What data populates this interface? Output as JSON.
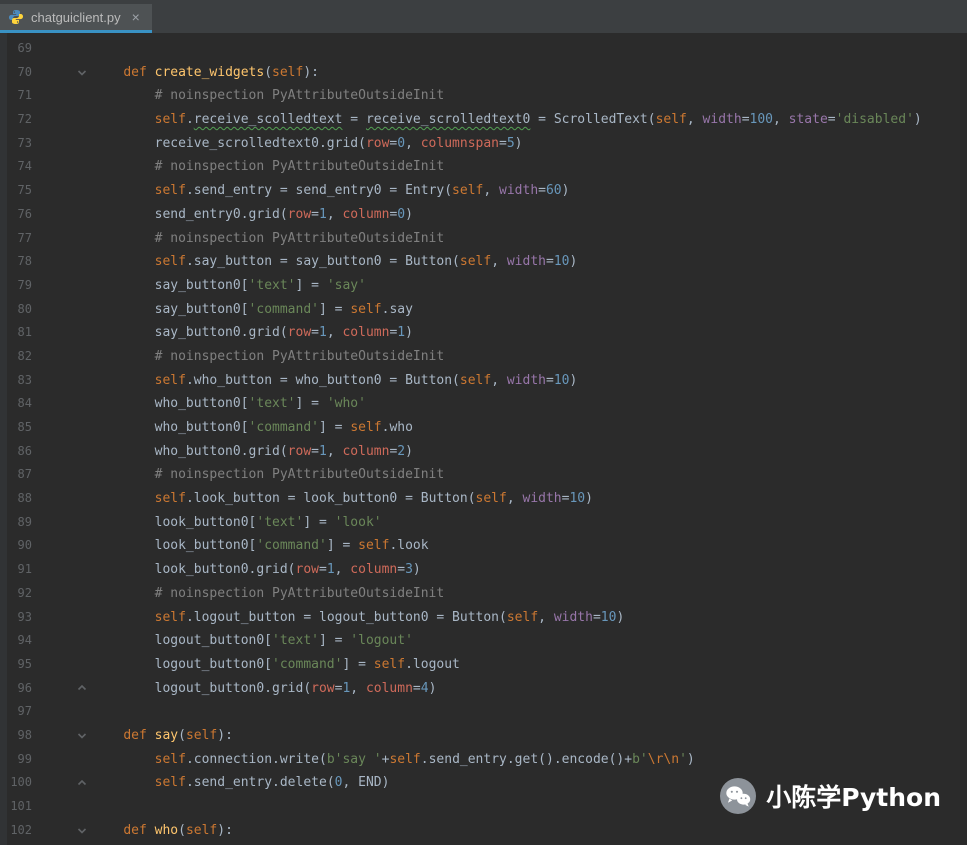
{
  "tab": {
    "filename": "chatguiclient.py",
    "close_label": "×"
  },
  "colors": {
    "editor_bg": "#2b2b2b",
    "tabbar_bg": "#3c3f41",
    "active_tab_bg": "#4e5254",
    "active_tab_accent": "#3992c4",
    "keyword": "#cc7832",
    "function_name": "#ffc66d",
    "string": "#6a8759",
    "number": "#6897bb",
    "comment": "#808080",
    "typo_squiggle": "#54a054"
  },
  "watermark": {
    "text": "小陈学Python"
  },
  "code": {
    "lines": [
      {
        "n": 69,
        "t": []
      },
      {
        "n": 70,
        "fold": "down",
        "t": [
          [
            "d",
            "    "
          ],
          [
            "k",
            "def"
          ],
          [
            "d",
            " "
          ],
          [
            "f",
            "create_widgets"
          ],
          [
            "d",
            "("
          ],
          [
            "k",
            "self"
          ],
          [
            "d",
            "):"
          ]
        ]
      },
      {
        "n": 71,
        "t": [
          [
            "d",
            "        "
          ],
          [
            "c",
            "# noinspection PyAttributeOutsideInit"
          ]
        ]
      },
      {
        "n": 72,
        "t": [
          [
            "d",
            "        "
          ],
          [
            "k",
            "self"
          ],
          [
            "d",
            "."
          ],
          [
            "u",
            "receive_scolledtext"
          ],
          [
            "d",
            " = "
          ],
          [
            "u",
            "receive_scrolledtext0"
          ],
          [
            "d",
            " = ScrolledText("
          ],
          [
            "k",
            "self"
          ],
          [
            "d",
            ", "
          ],
          [
            "p",
            "width"
          ],
          [
            "d",
            "="
          ],
          [
            "n",
            "100"
          ],
          [
            "d",
            ", "
          ],
          [
            "p",
            "state"
          ],
          [
            "d",
            "="
          ],
          [
            "s",
            "'disabled'"
          ],
          [
            "d",
            ")"
          ]
        ]
      },
      {
        "n": 73,
        "t": [
          [
            "d",
            "        receive_scrolledtext0.grid("
          ],
          [
            "r",
            "row"
          ],
          [
            "d",
            "="
          ],
          [
            "n",
            "0"
          ],
          [
            "d",
            ", "
          ],
          [
            "r",
            "columnspan"
          ],
          [
            "d",
            "="
          ],
          [
            "n",
            "5"
          ],
          [
            "d",
            ")"
          ]
        ]
      },
      {
        "n": 74,
        "t": [
          [
            "d",
            "        "
          ],
          [
            "c",
            "# noinspection PyAttributeOutsideInit"
          ]
        ]
      },
      {
        "n": 75,
        "t": [
          [
            "d",
            "        "
          ],
          [
            "k",
            "self"
          ],
          [
            "d",
            ".send_entry = send_entry0 = Entry("
          ],
          [
            "k",
            "self"
          ],
          [
            "d",
            ", "
          ],
          [
            "p",
            "width"
          ],
          [
            "d",
            "="
          ],
          [
            "n",
            "60"
          ],
          [
            "d",
            ")"
          ]
        ]
      },
      {
        "n": 76,
        "t": [
          [
            "d",
            "        send_entry0.grid("
          ],
          [
            "r",
            "row"
          ],
          [
            "d",
            "="
          ],
          [
            "n",
            "1"
          ],
          [
            "d",
            ", "
          ],
          [
            "r",
            "column"
          ],
          [
            "d",
            "="
          ],
          [
            "n",
            "0"
          ],
          [
            "d",
            ")"
          ]
        ]
      },
      {
        "n": 77,
        "t": [
          [
            "d",
            "        "
          ],
          [
            "c",
            "# noinspection PyAttributeOutsideInit"
          ]
        ]
      },
      {
        "n": 78,
        "t": [
          [
            "d",
            "        "
          ],
          [
            "k",
            "self"
          ],
          [
            "d",
            ".say_button = say_button0 = Button("
          ],
          [
            "k",
            "self"
          ],
          [
            "d",
            ", "
          ],
          [
            "p",
            "width"
          ],
          [
            "d",
            "="
          ],
          [
            "n",
            "10"
          ],
          [
            "d",
            ")"
          ]
        ]
      },
      {
        "n": 79,
        "t": [
          [
            "d",
            "        say_button0["
          ],
          [
            "s",
            "'text'"
          ],
          [
            "d",
            "] = "
          ],
          [
            "s",
            "'say'"
          ]
        ]
      },
      {
        "n": 80,
        "t": [
          [
            "d",
            "        say_button0["
          ],
          [
            "s",
            "'command'"
          ],
          [
            "d",
            "] = "
          ],
          [
            "k",
            "self"
          ],
          [
            "d",
            ".say"
          ]
        ]
      },
      {
        "n": 81,
        "t": [
          [
            "d",
            "        say_button0.grid("
          ],
          [
            "r",
            "row"
          ],
          [
            "d",
            "="
          ],
          [
            "n",
            "1"
          ],
          [
            "d",
            ", "
          ],
          [
            "r",
            "column"
          ],
          [
            "d",
            "="
          ],
          [
            "n",
            "1"
          ],
          [
            "d",
            ")"
          ]
        ]
      },
      {
        "n": 82,
        "t": [
          [
            "d",
            "        "
          ],
          [
            "c",
            "# noinspection PyAttributeOutsideInit"
          ]
        ]
      },
      {
        "n": 83,
        "t": [
          [
            "d",
            "        "
          ],
          [
            "k",
            "self"
          ],
          [
            "d",
            ".who_button = who_button0 = Button("
          ],
          [
            "k",
            "self"
          ],
          [
            "d",
            ", "
          ],
          [
            "p",
            "width"
          ],
          [
            "d",
            "="
          ],
          [
            "n",
            "10"
          ],
          [
            "d",
            ")"
          ]
        ]
      },
      {
        "n": 84,
        "t": [
          [
            "d",
            "        who_button0["
          ],
          [
            "s",
            "'text'"
          ],
          [
            "d",
            "] = "
          ],
          [
            "s",
            "'who'"
          ]
        ]
      },
      {
        "n": 85,
        "t": [
          [
            "d",
            "        who_button0["
          ],
          [
            "s",
            "'command'"
          ],
          [
            "d",
            "] = "
          ],
          [
            "k",
            "self"
          ],
          [
            "d",
            ".who"
          ]
        ]
      },
      {
        "n": 86,
        "t": [
          [
            "d",
            "        who_button0.grid("
          ],
          [
            "r",
            "row"
          ],
          [
            "d",
            "="
          ],
          [
            "n",
            "1"
          ],
          [
            "d",
            ", "
          ],
          [
            "r",
            "column"
          ],
          [
            "d",
            "="
          ],
          [
            "n",
            "2"
          ],
          [
            "d",
            ")"
          ]
        ]
      },
      {
        "n": 87,
        "t": [
          [
            "d",
            "        "
          ],
          [
            "c",
            "# noinspection PyAttributeOutsideInit"
          ]
        ]
      },
      {
        "n": 88,
        "t": [
          [
            "d",
            "        "
          ],
          [
            "k",
            "self"
          ],
          [
            "d",
            ".look_button = look_button0 = Button("
          ],
          [
            "k",
            "self"
          ],
          [
            "d",
            ", "
          ],
          [
            "p",
            "width"
          ],
          [
            "d",
            "="
          ],
          [
            "n",
            "10"
          ],
          [
            "d",
            ")"
          ]
        ]
      },
      {
        "n": 89,
        "t": [
          [
            "d",
            "        look_button0["
          ],
          [
            "s",
            "'text'"
          ],
          [
            "d",
            "] = "
          ],
          [
            "s",
            "'look'"
          ]
        ]
      },
      {
        "n": 90,
        "t": [
          [
            "d",
            "        look_button0["
          ],
          [
            "s",
            "'command'"
          ],
          [
            "d",
            "] = "
          ],
          [
            "k",
            "self"
          ],
          [
            "d",
            ".look"
          ]
        ]
      },
      {
        "n": 91,
        "t": [
          [
            "d",
            "        look_button0.grid("
          ],
          [
            "r",
            "row"
          ],
          [
            "d",
            "="
          ],
          [
            "n",
            "1"
          ],
          [
            "d",
            ", "
          ],
          [
            "r",
            "column"
          ],
          [
            "d",
            "="
          ],
          [
            "n",
            "3"
          ],
          [
            "d",
            ")"
          ]
        ]
      },
      {
        "n": 92,
        "t": [
          [
            "d",
            "        "
          ],
          [
            "c",
            "# noinspection PyAttributeOutsideInit"
          ]
        ]
      },
      {
        "n": 93,
        "t": [
          [
            "d",
            "        "
          ],
          [
            "k",
            "self"
          ],
          [
            "d",
            ".logout_button = logout_button0 = Button("
          ],
          [
            "k",
            "self"
          ],
          [
            "d",
            ", "
          ],
          [
            "p",
            "width"
          ],
          [
            "d",
            "="
          ],
          [
            "n",
            "10"
          ],
          [
            "d",
            ")"
          ]
        ]
      },
      {
        "n": 94,
        "t": [
          [
            "d",
            "        logout_button0["
          ],
          [
            "s",
            "'text'"
          ],
          [
            "d",
            "] = "
          ],
          [
            "s",
            "'logout'"
          ]
        ]
      },
      {
        "n": 95,
        "t": [
          [
            "d",
            "        logout_button0["
          ],
          [
            "s",
            "'command'"
          ],
          [
            "d",
            "] = "
          ],
          [
            "k",
            "self"
          ],
          [
            "d",
            ".logout"
          ]
        ]
      },
      {
        "n": 96,
        "fold": "up",
        "t": [
          [
            "d",
            "        logout_button0.grid("
          ],
          [
            "r",
            "row"
          ],
          [
            "d",
            "="
          ],
          [
            "n",
            "1"
          ],
          [
            "d",
            ", "
          ],
          [
            "r",
            "column"
          ],
          [
            "d",
            "="
          ],
          [
            "n",
            "4"
          ],
          [
            "d",
            ")"
          ]
        ]
      },
      {
        "n": 97,
        "t": []
      },
      {
        "n": 98,
        "fold": "down",
        "t": [
          [
            "d",
            "    "
          ],
          [
            "k",
            "def"
          ],
          [
            "d",
            " "
          ],
          [
            "f",
            "say"
          ],
          [
            "d",
            "("
          ],
          [
            "k",
            "self"
          ],
          [
            "d",
            "):"
          ]
        ]
      },
      {
        "n": 99,
        "t": [
          [
            "d",
            "        "
          ],
          [
            "k",
            "self"
          ],
          [
            "d",
            ".connection.write("
          ],
          [
            "s",
            "b'say '"
          ],
          [
            "d",
            "+"
          ],
          [
            "k",
            "self"
          ],
          [
            "d",
            ".send_entry.get().encode()+"
          ],
          [
            "s",
            "b'"
          ],
          [
            "e",
            "\\r\\n"
          ],
          [
            "s",
            "'"
          ],
          [
            "d",
            ")"
          ]
        ]
      },
      {
        "n": 100,
        "fold": "up",
        "t": [
          [
            "d",
            "        "
          ],
          [
            "k",
            "self"
          ],
          [
            "d",
            ".send_entry.delete("
          ],
          [
            "n",
            "0"
          ],
          [
            "d",
            ", END)"
          ]
        ]
      },
      {
        "n": 101,
        "t": []
      },
      {
        "n": 102,
        "fold": "down",
        "t": [
          [
            "d",
            "    "
          ],
          [
            "k",
            "def"
          ],
          [
            "d",
            " "
          ],
          [
            "f",
            "who"
          ],
          [
            "d",
            "("
          ],
          [
            "k",
            "self"
          ],
          [
            "d",
            "):"
          ]
        ]
      }
    ]
  }
}
